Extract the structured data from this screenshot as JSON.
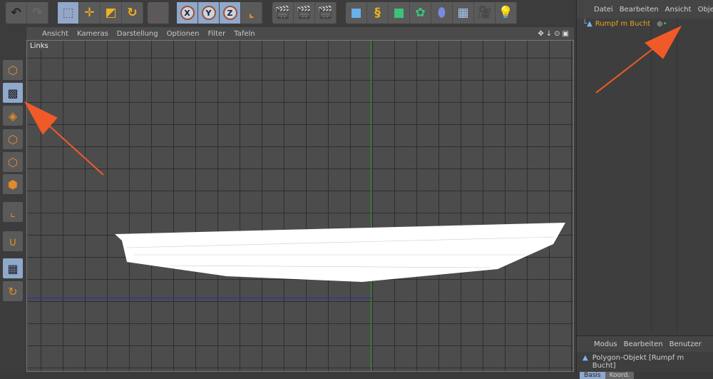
{
  "toolbar": {
    "groups": [
      {
        "name": "history",
        "icons": [
          "undo-icon",
          "redo-icon"
        ]
      },
      {
        "name": "tools",
        "icons": [
          "live-selection-icon",
          "move-icon",
          "scale-icon",
          "rotate-icon"
        ]
      },
      {
        "name": "selection",
        "icons": [
          "rectangle-selection-icon"
        ]
      },
      {
        "name": "axes",
        "icons": [
          "x-axis-lock-icon",
          "y-axis-lock-icon",
          "z-axis-lock-icon",
          "coordinate-system-icon"
        ]
      },
      {
        "name": "render",
        "icons": [
          "render-view-icon",
          "render-picture-viewer-icon",
          "render-settings-icon"
        ]
      },
      {
        "name": "objects",
        "icons": [
          "cube-icon",
          "spline-icon",
          "nurbs-icon",
          "array-icon",
          "deformer-icon",
          "floor-icon",
          "camera-icon",
          "light-icon"
        ]
      }
    ],
    "axis_labels": [
      "X",
      "Y",
      "Z"
    ]
  },
  "viewport": {
    "menu": [
      "Ansicht",
      "Kameras",
      "Darstellung",
      "Optionen",
      "Filter",
      "Tafeln"
    ],
    "label": "Links",
    "nav_icons": [
      "move-view-icon",
      "zoom-view-icon",
      "rotate-view-icon",
      "maximize-view-icon"
    ]
  },
  "left_toolbar": {
    "icons": [
      "model-mode-icon",
      "texture-mode-icon",
      "workplane-icon",
      "points-mode-icon",
      "edges-mode-icon",
      "polygons-mode-icon",
      "axis-mode-icon",
      "snap-icon",
      "lock-workplane-icon",
      "workplane-rotate-icon"
    ],
    "active": [
      "texture-mode-icon",
      "lock-workplane-icon"
    ]
  },
  "object_manager": {
    "menu": [
      "Datei",
      "Bearbeiten",
      "Ansicht",
      "Objekte"
    ],
    "objects": [
      {
        "name": "Rumpf m Bucht",
        "type": "polygon"
      }
    ]
  },
  "attribute_manager": {
    "menu": [
      "Modus",
      "Bearbeiten",
      "Benutzer"
    ],
    "title": "Polygon-Objekt [Rumpf m Bucht]",
    "tabs": [
      "Basis",
      "Koord."
    ]
  },
  "colors": {
    "accent_orange": "#e8a21f",
    "arrow": "#f05a28",
    "selected_blue": "#8fa8cc",
    "y_axis": "#2c9a2c",
    "z_axis": "#2a2ad0"
  }
}
